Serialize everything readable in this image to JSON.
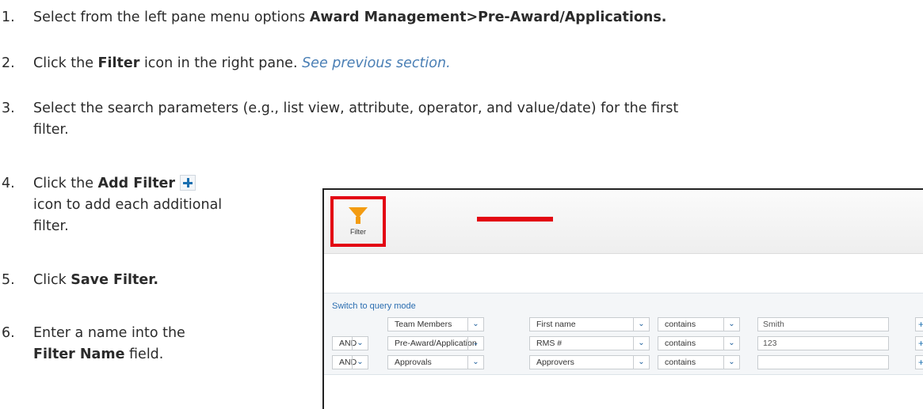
{
  "steps": [
    {
      "num": "1.",
      "pre": "Select from the left pane menu options ",
      "bold": "Award Management>Pre-Award/Applications."
    },
    {
      "num": "2.",
      "pre": "Click the ",
      "bold": "Filter",
      "post": " icon in the right pane. ",
      "link": "See previous section."
    },
    {
      "num": "3.",
      "line1": "Select the search parameters (e.g., list view, attribute, operator, and value/date) for the first",
      "line2": "filter."
    },
    {
      "num": "4.",
      "pre": "Click the ",
      "bold": "Add Filter",
      "line2": "icon to add each additional",
      "line3": "filter."
    },
    {
      "num": "5.",
      "pre": "Click ",
      "bold": "Save Filter."
    },
    {
      "num": "6.",
      "line1": "Enter a name into the",
      "bold": "Filter Name",
      "post": " field."
    }
  ],
  "screenshot": {
    "filter_label": "Filter",
    "query_link": "Switch to query mode",
    "rows": [
      {
        "conj": "",
        "view": "Team Members",
        "attr": "First name",
        "op": "contains",
        "value": "Smith"
      },
      {
        "conj": "AND",
        "view": "Pre-Award/Application",
        "attr": "RMS #",
        "op": "contains",
        "value": "123"
      },
      {
        "conj": "AND",
        "view": "Approvals",
        "attr": "Approvers",
        "op": "contains",
        "value": ""
      }
    ],
    "chevron_glyph": "⌄",
    "add_glyph": "+",
    "highlight_color": "#e30613",
    "funnel_color": "#f39c12"
  }
}
